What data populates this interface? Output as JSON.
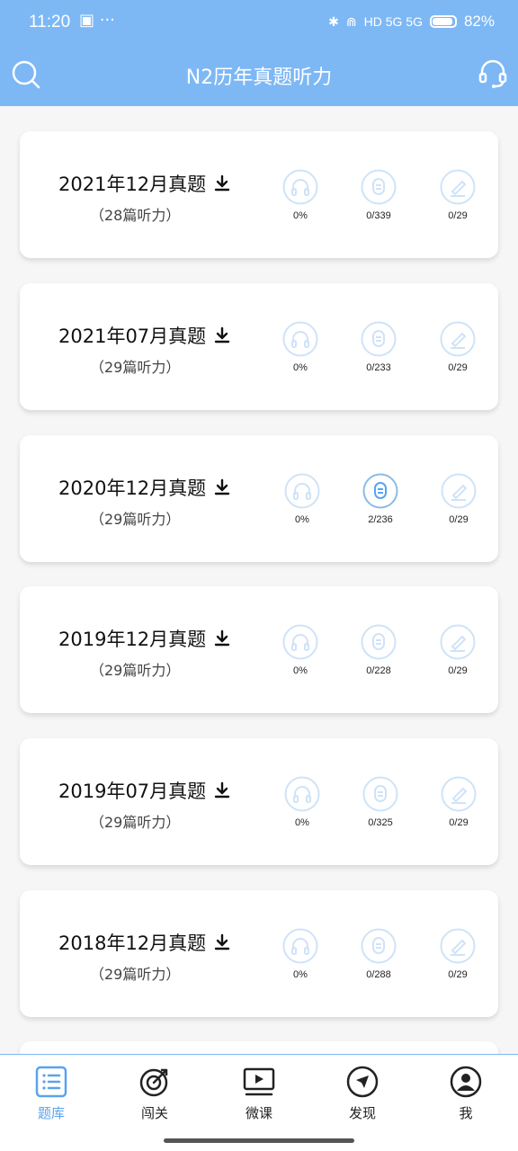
{
  "status_bar": {
    "time": "11:20",
    "left_extra": "▣ ···",
    "network_label": "HD 5G 5G",
    "battery": "82%"
  },
  "header": {
    "title": "N2历年真题听力",
    "search_icon": "search-icon",
    "support_icon": "headset-icon"
  },
  "exams": [
    {
      "title": "2021年12月真题",
      "subtitle": "（28篇听力）",
      "listen": "0%",
      "dictation": "0/339",
      "exercise": "0/29"
    },
    {
      "title": "2021年07月真题",
      "subtitle": "（29篇听力）",
      "listen": "0%",
      "dictation": "0/233",
      "exercise": "0/29"
    },
    {
      "title": "2020年12月真题",
      "subtitle": "（29篇听力）",
      "listen": "0%",
      "dictation": "2/236",
      "exercise": "0/29"
    },
    {
      "title": "2019年12月真题",
      "subtitle": "（29篇听力）",
      "listen": "0%",
      "dictation": "0/228",
      "exercise": "0/29"
    },
    {
      "title": "2019年07月真题",
      "subtitle": "（29篇听力）",
      "listen": "0%",
      "dictation": "0/325",
      "exercise": "0/29"
    },
    {
      "title": "2018年12月真题",
      "subtitle": "（29篇听力）",
      "listen": "0%",
      "dictation": "0/288",
      "exercise": "0/29"
    }
  ],
  "bottom_nav": [
    {
      "label": "题库",
      "icon": "list-icon",
      "active": true
    },
    {
      "label": "闯关",
      "icon": "target-icon",
      "active": false
    },
    {
      "label": "微课",
      "icon": "video-icon",
      "active": false
    },
    {
      "label": "发现",
      "icon": "compass-icon",
      "active": false
    },
    {
      "label": "我",
      "icon": "user-icon",
      "active": false
    }
  ],
  "colors": {
    "accent": "#7db8f5",
    "icon_light": "#cfe3f7",
    "active_nav": "#5aa3ee"
  }
}
